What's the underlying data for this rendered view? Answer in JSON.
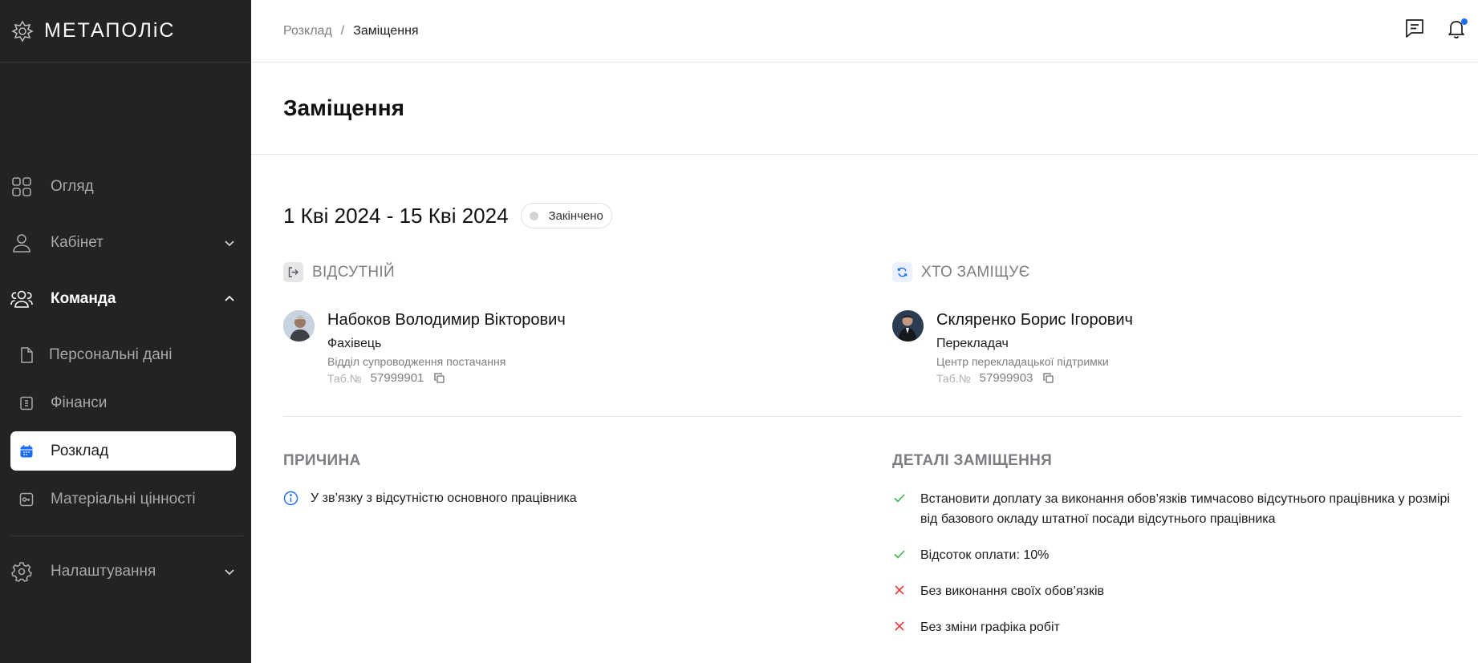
{
  "app": {
    "logo_text": "МЕТАПОЛіС"
  },
  "sidebar": {
    "items": [
      {
        "label": "Огляд",
        "icon": "grid-icon"
      },
      {
        "label": "Кабінет",
        "icon": "user-icon"
      },
      {
        "label": "Команда",
        "icon": "users-icon"
      },
      {
        "label": "Налаштування",
        "icon": "gear-icon"
      }
    ],
    "sub_items": [
      {
        "label": "Персональні дані",
        "icon": "document-icon"
      },
      {
        "label": "Фінанси",
        "icon": "wallet-icon"
      },
      {
        "label": "Розклад",
        "icon": "calendar-icon",
        "selected": true
      },
      {
        "label": "Матеріальні цінності",
        "icon": "key-card-icon"
      }
    ]
  },
  "breadcrumb": {
    "parent": "Розклад",
    "separator": "/",
    "current": "Заміщення"
  },
  "page": {
    "title": "Заміщення",
    "date_range": "1 Кві 2024 - 15 Кві 2024",
    "status": "Закінчено"
  },
  "absent": {
    "heading": "ВІДСУТНІЙ",
    "name": "Набоков Володимир Вікторович",
    "role": "Фахівець",
    "department": "Відділ супроводження постачання",
    "tab_label": "Таб.№",
    "tab_number": "57999901"
  },
  "substitute": {
    "heading": "ХТО ЗАМІЩУЄ",
    "name": "Скляренко Борис Ігорович",
    "role": "Перекладач",
    "department": "Центр перекладацької підтримки",
    "tab_label": "Таб.№",
    "tab_number": "57999903"
  },
  "reason": {
    "heading": "ПРИЧИНА",
    "text": "У зв’язку з відсутністю основного працівника"
  },
  "details": {
    "heading": "ДЕТАЛІ ЗАМІЩЕННЯ",
    "items": [
      {
        "line1": "Встановити доплату за виконання обов’язків тимчасово відсутнього працівника у розмірі",
        "line2": "від базового окладу штатної посади відсутнього працівника",
        "ok": true
      },
      {
        "line1": "Відсоток оплати: 10%",
        "ok": true
      },
      {
        "line1": "Без виконання своїх обов’язків",
        "ok": false
      },
      {
        "line1": "Без зміни графіка робіт",
        "ok": false
      }
    ]
  },
  "colors": {
    "sidebar_bg": "#232323",
    "accent_blue": "#1a6dff",
    "check_green": "#3bb54a",
    "cross_red": "#e5393a"
  }
}
